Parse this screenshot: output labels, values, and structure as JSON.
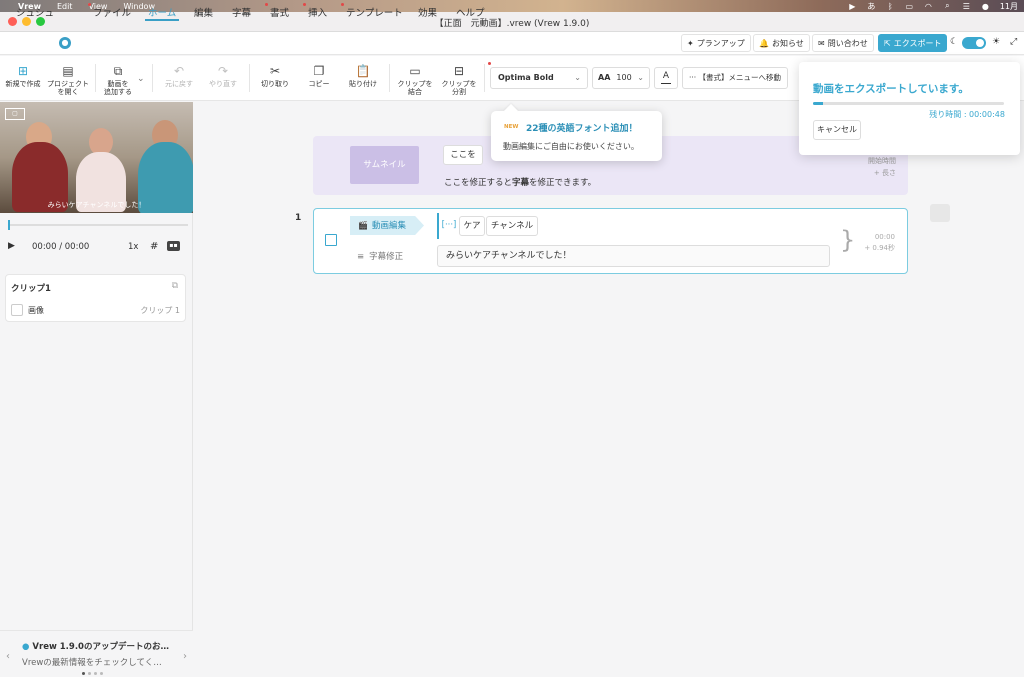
{
  "colors": {
    "accent": "#3aa8cf",
    "thumbnail_bg": "#ebe6f6",
    "thumbnail_button": "#cbbfe6",
    "new_badge": "#e8a23a"
  },
  "os_menubar": {
    "app": "Vrew",
    "items": [
      "Edit",
      "View",
      "Window"
    ],
    "status_icons": [
      "play-circle-icon",
      "input-method-icon",
      "bluetooth-icon",
      "battery-icon",
      "wifi-icon",
      "spotlight-icon",
      "control-center-icon",
      "siri-icon"
    ],
    "input_method": "あ",
    "clock": "11月"
  },
  "window": {
    "title": "【正面　元動画】.vrew (Vrew 1.9.0)"
  },
  "menu": {
    "user_name": "シュシュ",
    "tabs": [
      {
        "label": "ファイル",
        "dot": true
      },
      {
        "label": "ホーム",
        "dot": false,
        "active": true
      },
      {
        "label": "編集",
        "dot": false
      },
      {
        "label": "字幕",
        "dot": false
      },
      {
        "label": "書式",
        "dot": true
      },
      {
        "label": "挿入",
        "dot": true
      },
      {
        "label": "テンプレート",
        "dot": true
      },
      {
        "label": "効果",
        "dot": false
      },
      {
        "label": "ヘルプ",
        "dot": false
      }
    ],
    "plan_up": "プランアップ",
    "notice": "お知らせ",
    "contact": "問い合わせ",
    "export": "エクスポート"
  },
  "toolbar": {
    "new": "新規で作成",
    "open_project": "プロジェクト\nを開く",
    "add_video": "動画を\n追加する",
    "undo": "元に戻す",
    "redo": "やり直す",
    "cut": "切り取り",
    "copy": "コピー",
    "paste": "貼り付け",
    "merge": "クリップを\n結合",
    "split": "クリップを\n分割",
    "font": "Optima Bold",
    "font_size_icon": "AA",
    "font_size": "100",
    "color_letter": "A",
    "format_menu": "【書式】メニューへ移動"
  },
  "player": {
    "watermark": "logo",
    "subtitle_overlay": "みらいケアチャンネルでした！",
    "time_current": "00:00",
    "time_total": "/ 00:00",
    "speed": "1x",
    "progress": 0
  },
  "clips_panel": {
    "title": "クリップ1",
    "item_label": "画像",
    "item_right": "クリップ 1"
  },
  "news": {
    "title": "Vrew 1.9.0のアップデートのお…",
    "subtitle": "Vrewの最新情報をチェックしてく…",
    "page_count": 4,
    "page_index": 0
  },
  "thumbnail": {
    "button": "サムネイル",
    "chip": "ここを",
    "hint_pre": "ここを修正すると",
    "hint_bold": "字幕",
    "hint_post": "を修正できます。",
    "start_time": "開始時間",
    "length": "+ 長さ"
  },
  "clip_row": {
    "number": "1",
    "edit_label": "動画編集",
    "subtitle_label": "字幕修正",
    "words": [
      "[···]",
      "ケア",
      "チャンネル"
    ],
    "subtitle_text": "みらいケアチャンネルでした！",
    "time": "00:00",
    "duration": "+ 0.94秒"
  },
  "popover": {
    "badge": "NEW",
    "title": "22種の英語フォント追加！",
    "body": "動画編集にご自由にお使いください。"
  },
  "export_panel": {
    "title": "動画をエクスポートしています。",
    "progress": 0.05,
    "remaining": "残り時間 : 00:00:48",
    "cancel": "キャンセル"
  }
}
